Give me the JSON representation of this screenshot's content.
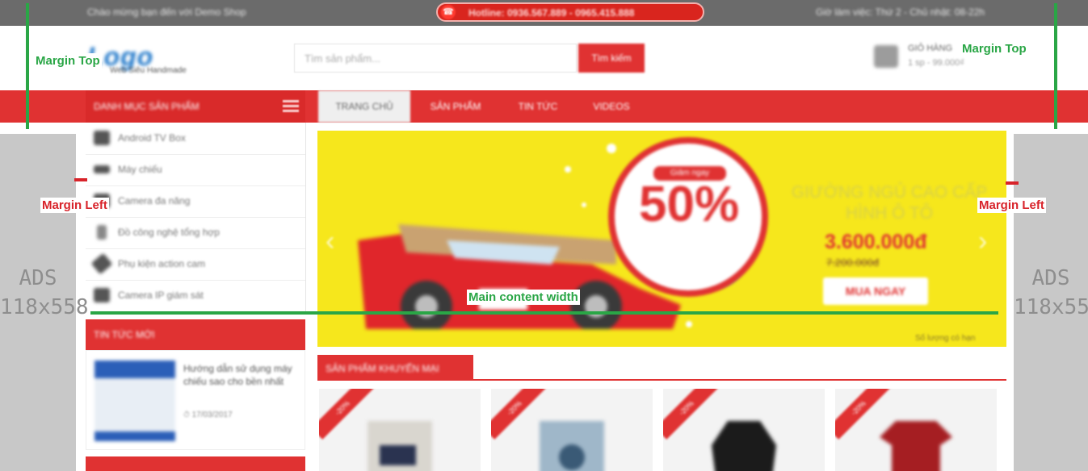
{
  "topbar": {
    "greeting": "Chào mừng bạn đến với Demo Shop",
    "hotline": "Hotline: 0936.567.889 - 0965.415.888",
    "hours": "Giờ làm việc: Thứ 2 - Chủ nhật: 08-22h"
  },
  "header": {
    "logo": "Logo",
    "logo_sub": "Web Siêu Handmade",
    "search_placeholder": "Tìm sản phẩm...",
    "search_button": "Tìm kiếm",
    "cart_title": "GIỎ HÀNG",
    "cart_summary": "1 sp - 99.000₫"
  },
  "nav": {
    "category_button": "DANH MỤC SẢN PHẨM",
    "tabs": [
      "TRANG CHỦ",
      "SẢN PHẨM",
      "TIN TỨC",
      "VIDEOS"
    ]
  },
  "categories": [
    {
      "label": "Android TV Box",
      "icon": "tv-box-icon"
    },
    {
      "label": "Máy chiếu",
      "icon": "projector-icon"
    },
    {
      "label": "Camera đa năng",
      "icon": "camera-icon"
    },
    {
      "label": "Đồ công nghệ tổng hợp",
      "icon": "gadget-icon"
    },
    {
      "label": "Phụ kiện action cam",
      "icon": "action-cam-icon"
    },
    {
      "label": "Camera IP giám sát",
      "icon": "ip-camera-icon"
    }
  ],
  "news": {
    "title": "TIN TỨC MỚI",
    "item_title": "Hướng dẫn sử dụng máy chiếu sao cho bền nhất",
    "item_date": "17/03/2017"
  },
  "banner": {
    "grab_label": "Giảm ngay",
    "discount": "50%",
    "headline": "GIƯỜNG NGỦ CAO CẤP HÌNH Ô TÔ",
    "price": "3.600.000đ",
    "old_price": "7.200.000đ",
    "buy_button": "MUA NGAY",
    "note": "Số lượng có hạn"
  },
  "products": {
    "section_title": "SẢN PHẨM KHUYẾN MẠI",
    "ribbon": "-20%",
    "items": [
      "product-1",
      "product-2",
      "product-3",
      "product-4"
    ]
  },
  "ads": {
    "label": "ADS",
    "left_size": "118x558",
    "right_size": "118x55"
  },
  "annotations": {
    "margin_top": "Margin Top",
    "margin_left": "Margin Left",
    "main_content_width": "Main content width"
  },
  "colors": {
    "accent_red": "#e03232",
    "topbar_gray": "#6b6b6b",
    "banner_yellow": "#f6e71c",
    "annotation_green": "#2aa646",
    "annotation_red": "#d8232a",
    "ads_gray": "#c8c8c8"
  }
}
